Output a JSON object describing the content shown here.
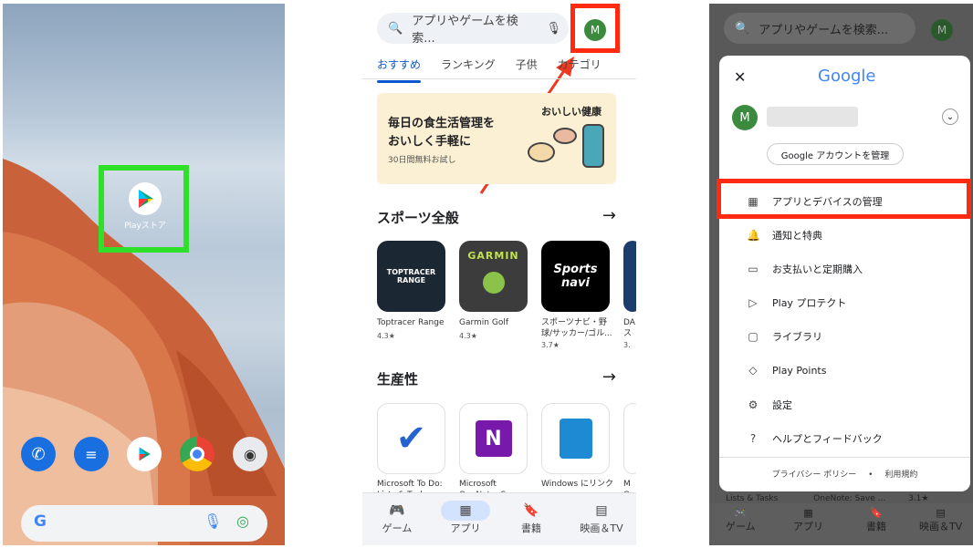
{
  "panel1": {
    "app_label": "Playストア",
    "dock_apps": [
      "phone-icon",
      "messages-icon",
      "play-store-icon",
      "chrome-icon",
      "camera-icon"
    ],
    "search_g": "G"
  },
  "panel2": {
    "search_placeholder": "アプリやゲームを検索...",
    "avatar_letter": "M",
    "tabs": [
      "おすすめ",
      "ランキング",
      "子供",
      "カテゴリ"
    ],
    "banner": {
      "line1": "毎日の食生活管理を",
      "line2": "おいしく手軽に",
      "sub": "30日間無料お試し",
      "brand": "おいしい健康"
    },
    "section1": "スポーツ全般",
    "apps1": [
      {
        "name": "Toptracer Range",
        "rating": "4.3★",
        "logo": "TOPTRACER RANGE"
      },
      {
        "name": "Garmin Golf",
        "rating": "4.3★",
        "logo": "GARMIN"
      },
      {
        "name": "スポーツナビ・野球/サッカー/ゴル...",
        "rating": "3.7★",
        "logo": "Sports navi"
      },
      {
        "name": "DA ス",
        "rating": "3.",
        "logo": ""
      }
    ],
    "section2": "生産性",
    "apps2": [
      {
        "name": "Microsoft To Do: Lists & Tasks",
        "logo": "✔"
      },
      {
        "name": "Microsoft OneNote: Save ...",
        "logo": "N"
      },
      {
        "name": "Windows にリンク",
        "logo": ""
      },
      {
        "name": "M O",
        "logo": ""
      }
    ],
    "nav": [
      {
        "icon": "🎮",
        "label": "ゲーム"
      },
      {
        "icon": "▦",
        "label": "アプリ"
      },
      {
        "icon": "🔖",
        "label": "書籍"
      },
      {
        "icon": "▤",
        "label": "映画＆TV"
      }
    ]
  },
  "panel3": {
    "search_placeholder": "アプリやゲームを検索...",
    "avatar_letter": "M",
    "google": "Google",
    "manage_account": "Google アカウントを管理",
    "menu": [
      {
        "icon": "▦",
        "label": "アプリとデバイスの管理"
      },
      {
        "icon": "🔔",
        "label": "通知と特典"
      },
      {
        "icon": "▭",
        "label": "お支払いと定期購入"
      },
      {
        "icon": "▷",
        "label": "Play プロテクト"
      },
      {
        "icon": "▢",
        "label": "ライブラリ"
      },
      {
        "icon": "◇",
        "label": "Play Points"
      },
      {
        "icon": "⚙",
        "label": "設定"
      },
      {
        "icon": "?",
        "label": "ヘルプとフィードバック"
      }
    ],
    "footer_privacy": "プライバシー ポリシー",
    "footer_dot": "•",
    "footer_terms": "利用規約",
    "below_texts": [
      "Lists & Tasks",
      "OneNote: Save ...",
      "3.1★"
    ],
    "nav": [
      {
        "icon": "🎮",
        "label": "ゲーム"
      },
      {
        "icon": "▦",
        "label": "アプリ"
      },
      {
        "icon": "🔖",
        "label": "書籍"
      },
      {
        "icon": "▤",
        "label": "映画＆TV"
      }
    ]
  }
}
